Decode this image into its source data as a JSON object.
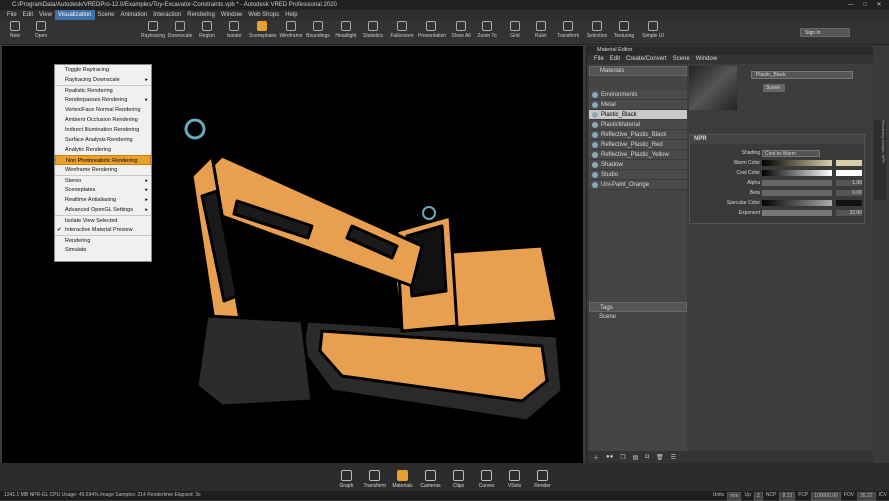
{
  "titlebar": {
    "title": "C:/ProgramData/Autodesk/VREDPro-12.0/Examples/Toy-Excavator-Constraints.vpb * - Autodesk VRED Professional 2020",
    "min": "—",
    "max": "□",
    "close": "✕"
  },
  "menubar": [
    "File",
    "Edit",
    "View",
    "Visualization",
    "Scene",
    "Animation",
    "Interaction",
    "Rendering",
    "Window",
    "Web Shops",
    "Help"
  ],
  "toolbar": [
    {
      "label": "New",
      "icon": "new-icon"
    },
    {
      "label": "Open",
      "icon": "open-icon"
    },
    {
      "label": "Raytracing",
      "icon": "raytracing-icon"
    },
    {
      "label": "Downscale",
      "icon": "downscale-icon"
    },
    {
      "label": "Region",
      "icon": "region-icon"
    },
    {
      "label": "Isolate",
      "icon": "isolate-icon"
    },
    {
      "label": "Sceneplates",
      "icon": "sceneplates-icon"
    },
    {
      "label": "Wireframe",
      "icon": "wireframe-icon"
    },
    {
      "label": "Boundings",
      "icon": "boundings-icon"
    },
    {
      "label": "Headlight",
      "icon": "headlight-icon"
    },
    {
      "label": "Statistics",
      "icon": "statistics-icon"
    },
    {
      "label": "Fullscreen",
      "icon": "fullscreen-icon"
    },
    {
      "label": "Presentation",
      "icon": "presentation-icon"
    },
    {
      "label": "Show All",
      "icon": "show-all-icon"
    },
    {
      "label": "Zoom To",
      "icon": "zoom-to-icon"
    },
    {
      "label": "Grid",
      "icon": "grid-icon"
    },
    {
      "label": "Ruler",
      "icon": "ruler-icon"
    },
    {
      "label": "Transform",
      "icon": "transform-icon"
    },
    {
      "label": "Selection",
      "icon": "selection-icon"
    },
    {
      "label": "Texturing",
      "icon": "texturing-icon"
    },
    {
      "label": "Simple UI",
      "icon": "simple-ui-icon"
    }
  ],
  "signin": "Sign In",
  "vis_menu": [
    {
      "label": "Toggle Raytracing",
      "check": "",
      "sub": false
    },
    {
      "label": "Raytracing Downscale",
      "check": "",
      "sub": true
    },
    {
      "label": "Realistic Rendering",
      "check": "",
      "sub": false,
      "sep": true
    },
    {
      "label": "Renderpasses Rendering",
      "check": "",
      "sub": true
    },
    {
      "label": "Vertex/Face Normal Rendering",
      "check": "",
      "sub": false
    },
    {
      "label": "Ambient Occlusion Rendering",
      "check": "",
      "sub": false
    },
    {
      "label": "Indirect Illumination Rendering",
      "check": "",
      "sub": false
    },
    {
      "label": "Surface Analysis Rendering",
      "check": "",
      "sub": false
    },
    {
      "label": "Analytic Rendering",
      "check": "",
      "sub": false
    },
    {
      "label": "Non Photorealistic Rendering",
      "check": "",
      "sub": false,
      "hl": true
    },
    {
      "label": "Wireframe Rendering",
      "check": "",
      "sub": false
    },
    {
      "label": "Stereo",
      "check": "",
      "sub": true,
      "sep": true
    },
    {
      "label": "Sceneplates",
      "check": "",
      "sub": true
    },
    {
      "label": "Realtime Antialiasing",
      "check": "",
      "sub": true
    },
    {
      "label": "Advanced OpenGL Settings",
      "check": "",
      "sub": true
    },
    {
      "label": "Isolate View Selected",
      "check": "",
      "sub": false,
      "sep": true
    },
    {
      "label": "Interactive Material Preview",
      "check": "✔",
      "sub": false
    },
    {
      "label": "Rendering",
      "check": "",
      "sub": false,
      "sep": true
    },
    {
      "label": "Simulate",
      "check": "",
      "sub": false
    }
  ],
  "mat_editor": {
    "title": "Material Editor",
    "menu": [
      "File",
      "Edit",
      "Create/Convert",
      "Scene",
      "Window"
    ],
    "list_header": "Materials",
    "materials": [
      "Environments",
      "Metal",
      "Plastic_Black",
      "PlasticMaterial",
      "Reflective_Plastic_Black",
      "Reflective_Plastic_Red",
      "Reflective_Plastic_Yellow",
      "Shadow",
      "Studio",
      "Uni-Paint_Orange"
    ],
    "selected": "Plastic_Black",
    "name": "Plastic_Black",
    "scene_tag": "Scene",
    "npr": {
      "head": "NPR",
      "shading_label": "Shading",
      "shading_value": "Cool-to-Warm",
      "warm_label": "Warm Color",
      "cool_label": "Cool Color",
      "alpha_label": "Alpha",
      "alpha_value": "1.00",
      "beta_label": "Beta",
      "beta_value": "0.00",
      "spec_label": "Specular Color",
      "exp_label": "Exponent",
      "exp_value": "32.00"
    },
    "tags_header": "Tags",
    "tags_scene": "Scene"
  },
  "side_tabs": "Rendering  Analytic  NPR",
  "bottom_toolbar": [
    {
      "label": "Graph",
      "active": false
    },
    {
      "label": "Transform",
      "active": false
    },
    {
      "label": "Materials",
      "active": true
    },
    {
      "label": "Cameras",
      "active": false
    },
    {
      "label": "Clips",
      "active": false
    },
    {
      "label": "Curves",
      "active": false
    },
    {
      "label": "VSets",
      "active": false
    },
    {
      "label": "Render",
      "active": false
    }
  ],
  "status": {
    "text": "1241.1 MB  NPR-GL CPU Usage: 40.694% Image Samples: 214 Rendertime Elapsed: 3s",
    "units_label": "Units",
    "units": "mm",
    "up_label": "Up",
    "up": "Z",
    "ncp_label": "NCP",
    "ncp": "8.13",
    "fcp_label": "FCP",
    "fcp": "100000.00",
    "fov_label": "FOV",
    "fov": "35.22",
    "icv": "ICV"
  }
}
